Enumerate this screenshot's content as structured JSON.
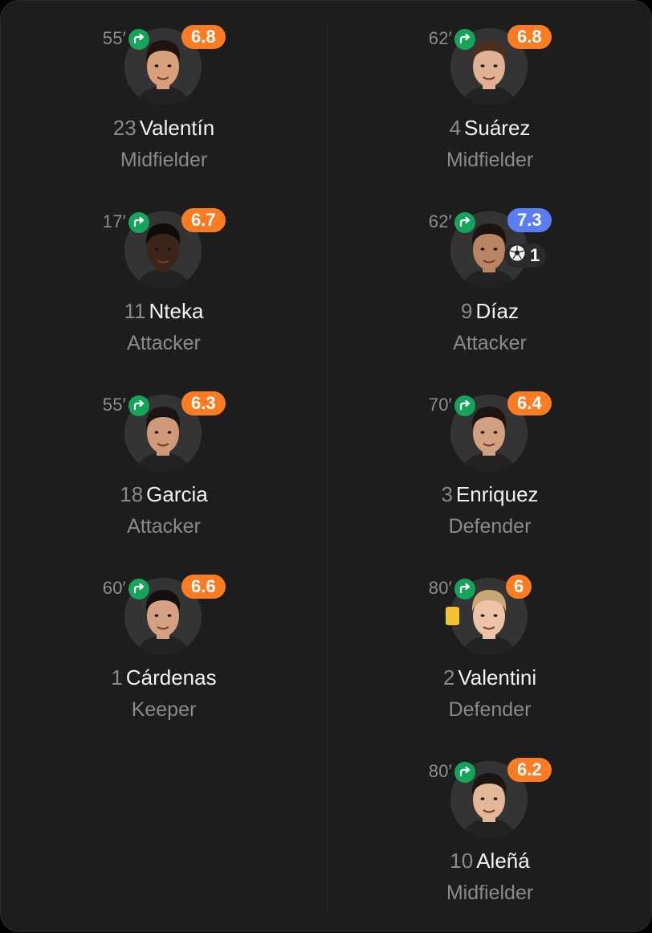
{
  "left": [
    {
      "minute": "55′",
      "rating": "6.8",
      "rating_color": "#fb7c23",
      "number": "23",
      "name": "Valentín",
      "position": "Midfielder",
      "skin": "#d9a07c",
      "hair": "#1d1410"
    },
    {
      "minute": "17′",
      "rating": "6.7",
      "rating_color": "#fb7c23",
      "number": "11",
      "name": "Nteka",
      "position": "Attacker",
      "skin": "#3b2418",
      "hair": "#0f0b09"
    },
    {
      "minute": "55′",
      "rating": "6.3",
      "rating_color": "#fb7c23",
      "number": "18",
      "name": "Garcia",
      "position": "Attacker",
      "skin": "#cf9a78",
      "hair": "#1a1412"
    },
    {
      "minute": "60′",
      "rating": "6.6",
      "rating_color": "#fb7c23",
      "number": "1",
      "name": "Cárdenas",
      "position": "Keeper",
      "skin": "#d4a182",
      "hair": "#130f0d"
    }
  ],
  "right": [
    {
      "minute": "62′",
      "rating": "6.8",
      "rating_color": "#fb7c23",
      "number": "4",
      "name": "Suárez",
      "position": "Midfielder",
      "skin": "#e0b195",
      "hair": "#4a2f20"
    },
    {
      "minute": "62′",
      "rating": "7.3",
      "rating_color": "#5a7df3",
      "number": "9",
      "name": "Díaz",
      "position": "Attacker",
      "skin": "#b98462",
      "hair": "#1b1411",
      "goals": "1"
    },
    {
      "minute": "70′",
      "rating": "6.4",
      "rating_color": "#fb7c23",
      "number": "3",
      "name": "Enriquez",
      "position": "Defender",
      "skin": "#d3a080",
      "hair": "#1c1411"
    },
    {
      "minute": "80′",
      "rating": "6",
      "rating_color": "#fb7c23",
      "number": "2",
      "name": "Valentini",
      "position": "Defender",
      "skin": "#ecc3a6",
      "hair": "#c9a876",
      "yellow_card": true
    },
    {
      "minute": "80′",
      "rating": "6.2",
      "rating_color": "#fb7c23",
      "number": "10",
      "name": "Aleñá",
      "position": "Midfielder",
      "skin": "#e3b898",
      "hair": "#1c1613"
    }
  ],
  "icons": {
    "substitution": "sub-arrow-icon",
    "goal": "football-icon",
    "card": "yellow-card-icon"
  }
}
